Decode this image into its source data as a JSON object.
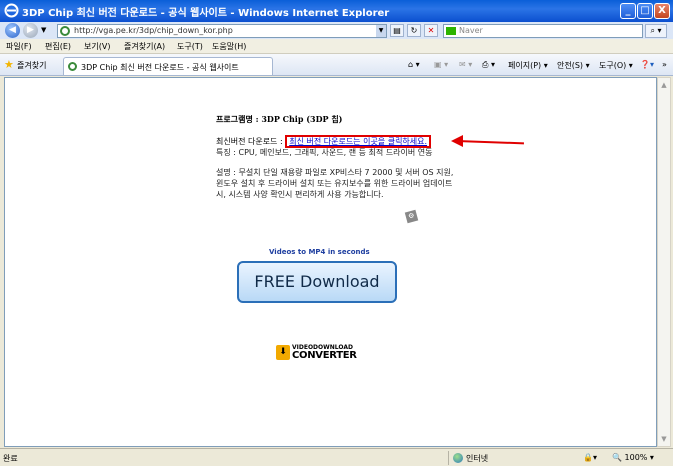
{
  "window": {
    "title": "3DP Chip 최신 버전 다운로드 - 공식 웹사이트 - Windows Internet Explorer",
    "min_glyph": "_",
    "max_glyph": "□",
    "close_glyph": "X"
  },
  "address": {
    "url": "http://vga.pe.kr/3dp/chip_down_kor.php",
    "search_placeholder": "Naver"
  },
  "menu": {
    "items": [
      "파일(F)",
      "편집(E)",
      "보기(V)",
      "즐겨찾기(A)",
      "도구(T)",
      "도움말(H)"
    ]
  },
  "favorites": {
    "label": "즐겨찾기",
    "tab_title": "3DP Chip 최신 버전 다운로드 - 공식 웹사이트",
    "commands": [
      "페이지(P) ▾",
      "안전(S) ▾",
      "도구(O) ▾"
    ]
  },
  "page": {
    "program_label": "프로그램명 : 3DP Chip (3DP 칩)",
    "latest_prefix": "최신버전 다운로드 : ",
    "latest_link": "최신 버전 다운로드는 이곳을 클릭하세요.",
    "features": "특징 : CPU, 메인보드, 그래픽, 사운드, 랜 등 최적 드라이버 연동",
    "description": "설명 : 무설치 단일 재용량 파일로 XP비스타 7 2000 및 서버 OS 지원, 윈도우 설치 후 드라이버 설치 또는 유지보수를 위한 드라이버 업데이트시, 시스템 사양 확인시 편리하게 사용 가능합니다.",
    "ad_caption": "Videos to MP4 in seconds",
    "ad_button": "FREE Download",
    "logo_top": "VIDEODOWNLOAD",
    "logo_bottom": "CONVERTER"
  },
  "status": {
    "text": "완료",
    "zone": "인터넷",
    "zoom": "100%"
  },
  "colors": {
    "title_bar": "#0a5fd8",
    "link": "#0000cc",
    "highlight": "#e00000",
    "ad_button": "#b9d9f6"
  }
}
